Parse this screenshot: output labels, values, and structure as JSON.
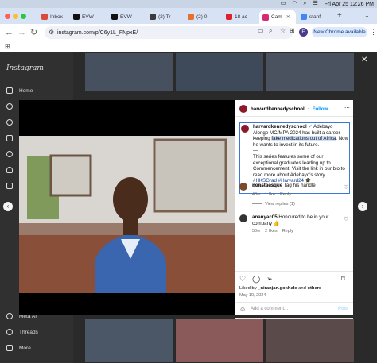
{
  "menubar": {
    "clock": "Fri Apr 25  12:26 PM"
  },
  "tabs": [
    {
      "label": "Inbox",
      "color": "#d94b3c"
    },
    {
      "label": "EVW",
      "color": "#111111"
    },
    {
      "label": "EVW",
      "color": "#111111"
    },
    {
      "label": "(2) Tr",
      "color": "#3b3b3b"
    },
    {
      "label": "(2) 0",
      "color": "#e8702a"
    },
    {
      "label": "18 ac",
      "color": "#e0202a"
    },
    {
      "label": "Cam",
      "color": "#d62976"
    },
    {
      "label": "stanf",
      "color": "#4285f4"
    }
  ],
  "toolbar": {
    "url": "instagram.com/p/C6y1L_FNpxE/",
    "profile_initial": "E",
    "new_chrome": "New Chrome available",
    "icons": [
      "tune-icon",
      "cast-icon",
      "zoom-icon",
      "star-icon",
      "extensions-icon"
    ]
  },
  "sidebar": {
    "logo": "Instagram",
    "home": "Home",
    "meta_ai": "Meta AI",
    "threads": "Threads",
    "more": "More"
  },
  "post": {
    "username": "harvardkennedyschool",
    "follow": "Follow",
    "caption_user": "harvardkennedyschool",
    "caption_part1": "Adebayo Alonge MC/MPA 2024 has built a career keeping",
    "caption_highlight": "fake medications out of Africa",
    "caption_part2": ". Now he wants to invest in its future.",
    "caption_dash": "—",
    "caption_body": "This series features some of our exceptional graduates leading up to Commencement. Visit the link in our bio to read more about Adebayo's story.",
    "hashtags": "#HKSGrad #Harvard24 🎓",
    "edited": "Edited · 48w",
    "comments": [
      {
        "user": "nonstaesque",
        "text": "Tag his handle",
        "time": "43w",
        "likes": "1 like",
        "reply": "Reply",
        "view_replies": "View replies (1)"
      },
      {
        "user": "ananyac05",
        "text": "Honoured to be in your company",
        "emoji": "👍",
        "time": "50w",
        "likes": "2 likes",
        "reply": "Reply"
      }
    ],
    "liked_by_prefix": "Liked by",
    "liked_by_user": "_niranjan.gokhale",
    "liked_by_suffix": "and",
    "liked_by_others": "others",
    "date": "May 10, 2024",
    "add_comment": "Add a comment...",
    "post_btn": "Post"
  }
}
